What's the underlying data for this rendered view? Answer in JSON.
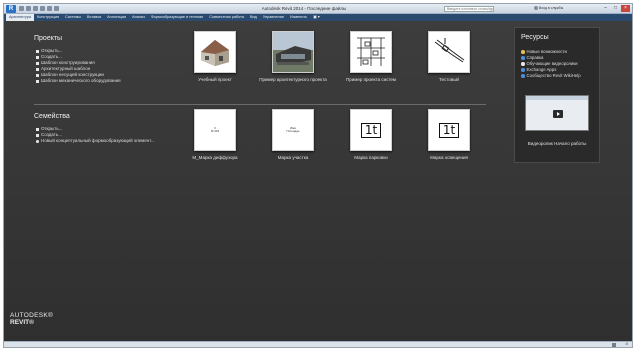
{
  "window": {
    "app_button": "R",
    "title": "Autodesk Revit 2014 - Последние файлы",
    "search_placeholder": "Введите ключевое слово/фразу",
    "signin": "Вход в службы",
    "minimize": "–",
    "maximize": "□",
    "close": "×"
  },
  "ribbon": {
    "tabs": [
      {
        "label": "Архитектура"
      },
      {
        "label": "Конструкция"
      },
      {
        "label": "Системы"
      },
      {
        "label": "Вставка"
      },
      {
        "label": "Аннотации"
      },
      {
        "label": "Анализ"
      },
      {
        "label": "Формообразующие и генплан"
      },
      {
        "label": "Совместная работа"
      },
      {
        "label": "Вид"
      },
      {
        "label": "Управление"
      },
      {
        "label": "Изменить"
      }
    ],
    "extra": "▣ ▾"
  },
  "projects": {
    "title": "Проекты",
    "links": [
      "Открыть...",
      "Создать...",
      "Шаблон конструирования",
      "Архитектурный шаблон",
      "Шаблон несущей конструкции",
      "Шаблон механического оборудования"
    ],
    "recent": [
      {
        "caption": "Учебный проект",
        "icon": "house-model-icon"
      },
      {
        "caption": "Пример архитектурного проекта",
        "icon": "building-render-icon"
      },
      {
        "caption": "Пример проекта систем",
        "icon": "mep-systems-icon"
      },
      {
        "caption": "Тестовый",
        "icon": "pipe-drawing-icon"
      }
    ]
  },
  "families": {
    "title": "Семейства",
    "links": [
      "Открыть...",
      "Создать...",
      "Новый концептуальный формообразующий элемент..."
    ],
    "recent": [
      {
        "caption": "M_Марка диффузора",
        "thumb_text": "≡\nM 415"
      },
      {
        "caption": "Марка участка",
        "thumb_text": "Имя\nПлощадь"
      },
      {
        "caption": "Марка парковки",
        "thumb_text": "1t"
      },
      {
        "caption": "Марка освещения",
        "thumb_text": "1t"
      }
    ]
  },
  "resources": {
    "title": "Ресурсы",
    "links": [
      {
        "label": "Новые возможности",
        "icon": "star-icon"
      },
      {
        "label": "Справка",
        "icon": "help-icon"
      },
      {
        "label": "Обучающие видеоролики",
        "icon": "video-icon"
      },
      {
        "label": "Exchange Apps",
        "icon": "exchange-icon"
      },
      {
        "label": "Сообщество Revit WikiHelp",
        "icon": "community-icon"
      }
    ],
    "video_caption": "Видеоролик Начало работы"
  },
  "logo": {
    "line1": "AUTODESK®",
    "line2": "REVIT®"
  },
  "status": {
    "value": ":0"
  }
}
